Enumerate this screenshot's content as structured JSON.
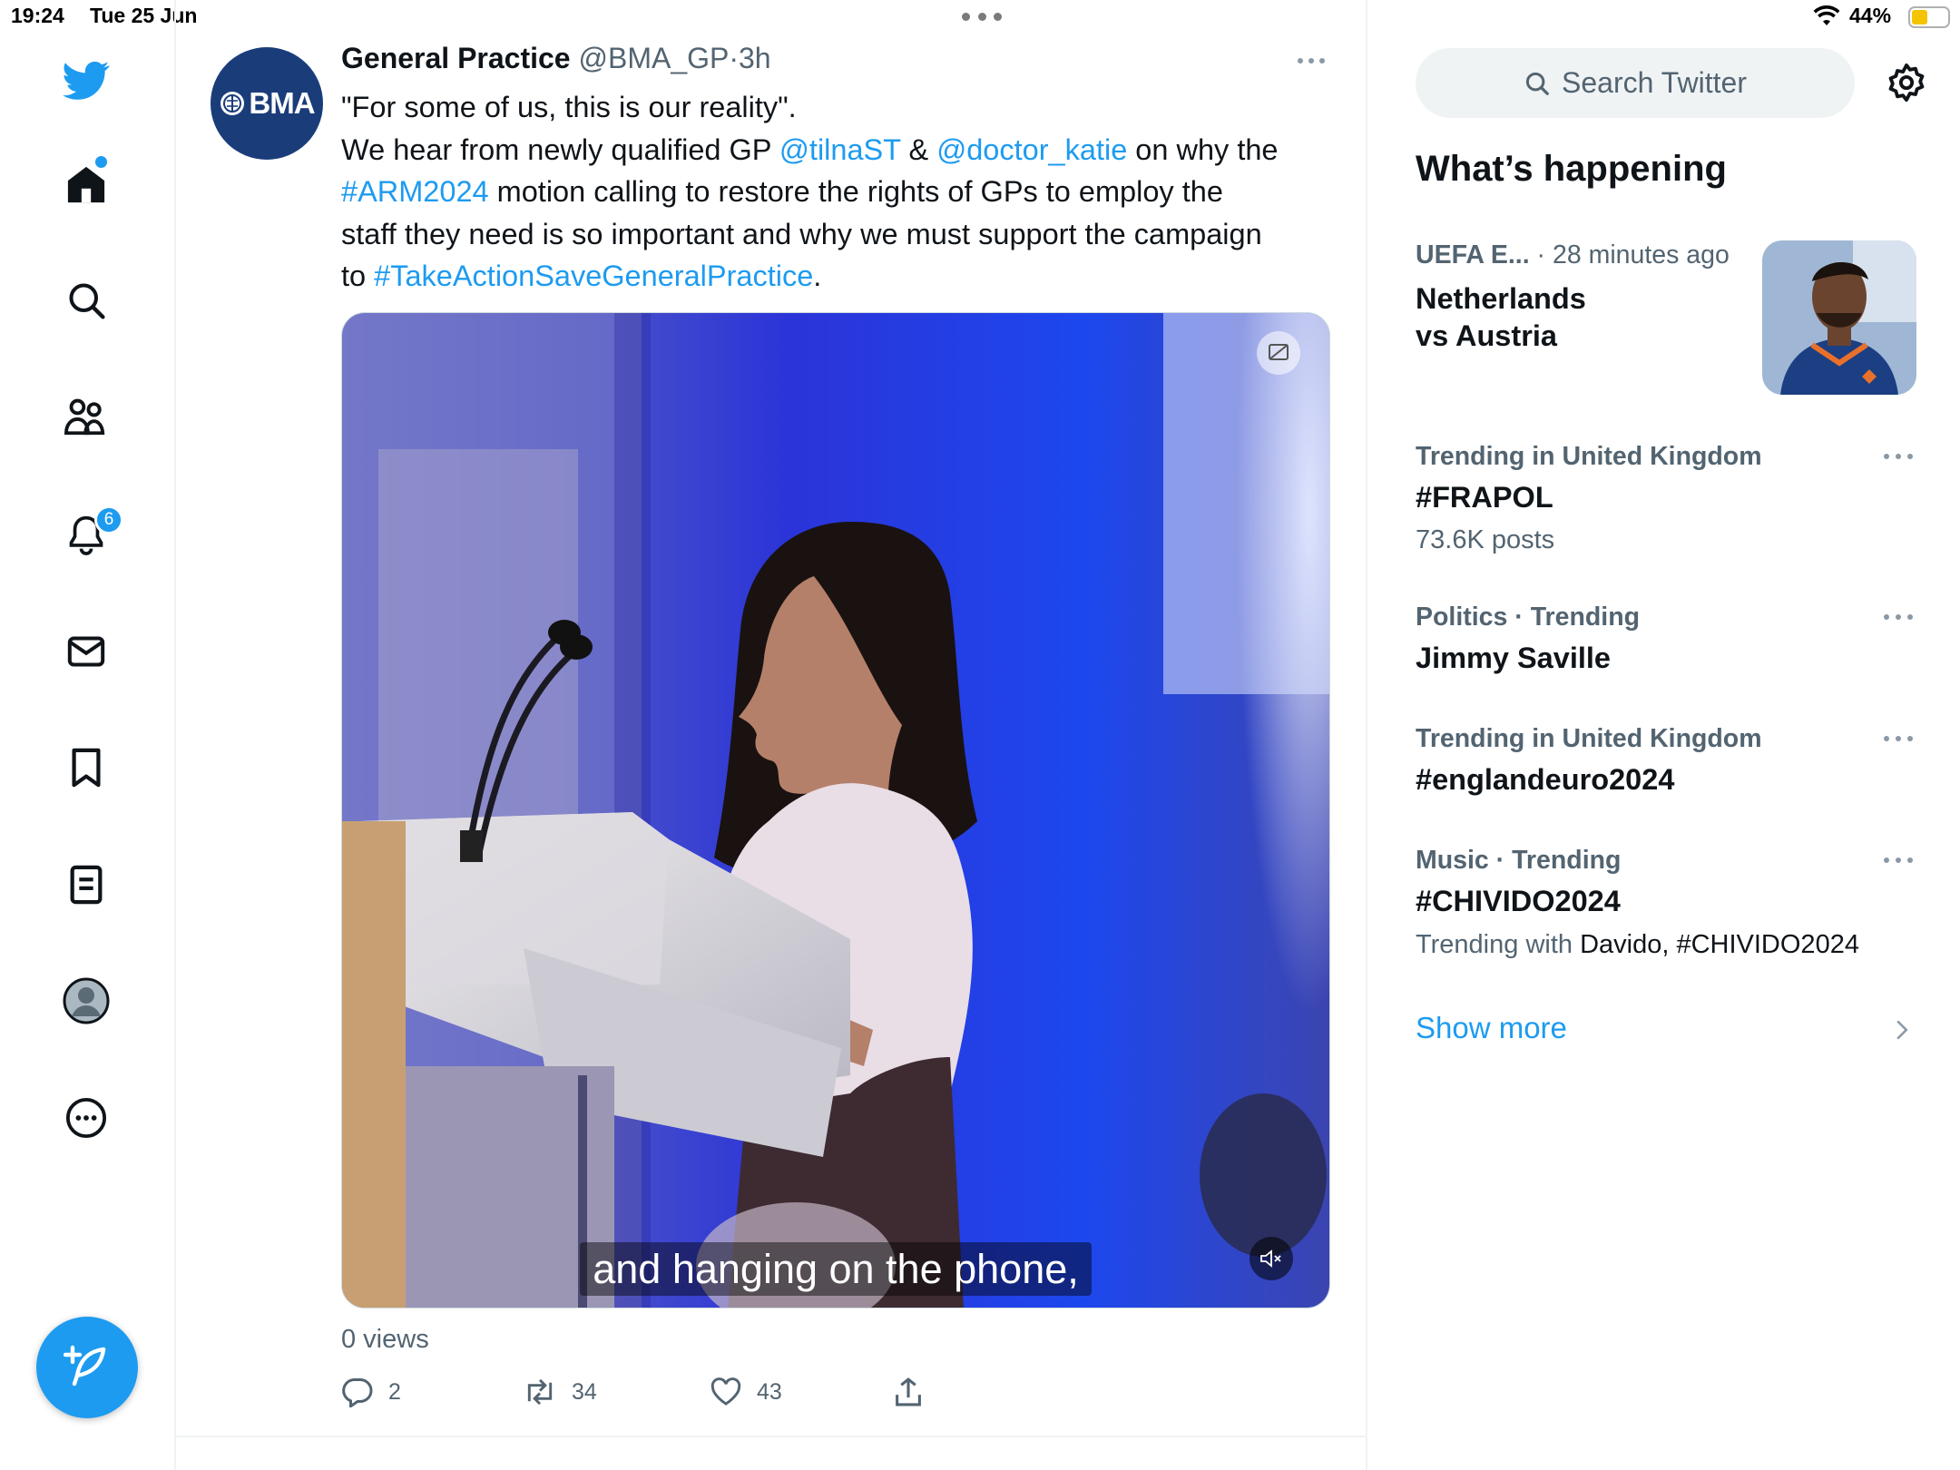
{
  "status_bar": {
    "time": "19:24",
    "date": "Tue 25 Jun",
    "battery": "44%",
    "icons": [
      "wifi-icon",
      "battery-icon",
      "more-dots-icon"
    ]
  },
  "nav": {
    "items": [
      {
        "icon": "twitter-bird-icon"
      },
      {
        "icon": "home-icon",
        "indicator_dot": true
      },
      {
        "icon": "search-icon"
      },
      {
        "icon": "communities-icon"
      },
      {
        "icon": "notifications-bell-icon",
        "badge": "6"
      },
      {
        "icon": "messages-envelope-icon"
      },
      {
        "icon": "bookmarks-icon"
      },
      {
        "icon": "lists-icon"
      },
      {
        "icon": "profile-avatar-icon"
      },
      {
        "icon": "more-options-icon"
      }
    ],
    "compose_icon": "compose-feather-icon",
    "accent": "#1d9bf0"
  },
  "tweet": {
    "avatar_text": "BMA",
    "avatar_color": "#1a3d7a",
    "display_name": "General Practice",
    "handle": "@BMA_GP",
    "separator": "·",
    "time": "3h",
    "text_line1": "\"For some of us, this is our reality\".",
    "text_line2_a": "We hear from newly qualified GP ",
    "mention1": "@tilnaST",
    "text_amp": " & ",
    "mention2": "@doctor_katie",
    "text_line2_b": " on why the",
    "hashtag1": "#ARM2024",
    "text_line3_a": " motion calling  to restore the rights of GPs to employ the",
    "text_line4": "staff they need is so important and why we must support the campaign",
    "text_line5_a": "to ",
    "hashtag2": "#TakeActionSaveGeneralPractice",
    "text_line5_b": ".",
    "video_caption": "and hanging on the phone,",
    "views": "0 views",
    "replies": "2",
    "retweets": "34",
    "likes": "43"
  },
  "sidebar": {
    "search_placeholder": "Search Twitter",
    "heading": "What’s happening",
    "event": {
      "category": "UEFA E...",
      "meta": " · 28 minutes ago",
      "title_line1": "Netherlands",
      "title_line2": "vs Austria"
    },
    "trends": [
      {
        "context": "Trending in United Kingdom",
        "title": "#FRAPOL",
        "posts": "73.6K posts"
      },
      {
        "context": "Politics · Trending",
        "title": "Jimmy Saville"
      },
      {
        "context": "Trending in United Kingdom",
        "title": "#englandeuro2024"
      },
      {
        "context": "Music · Trending",
        "title": "#CHIVIDO2024",
        "trending_with_label": "Trending with ",
        "trending_with": "Davido, #CHIVIDO2024"
      }
    ],
    "show_more": "Show more"
  }
}
